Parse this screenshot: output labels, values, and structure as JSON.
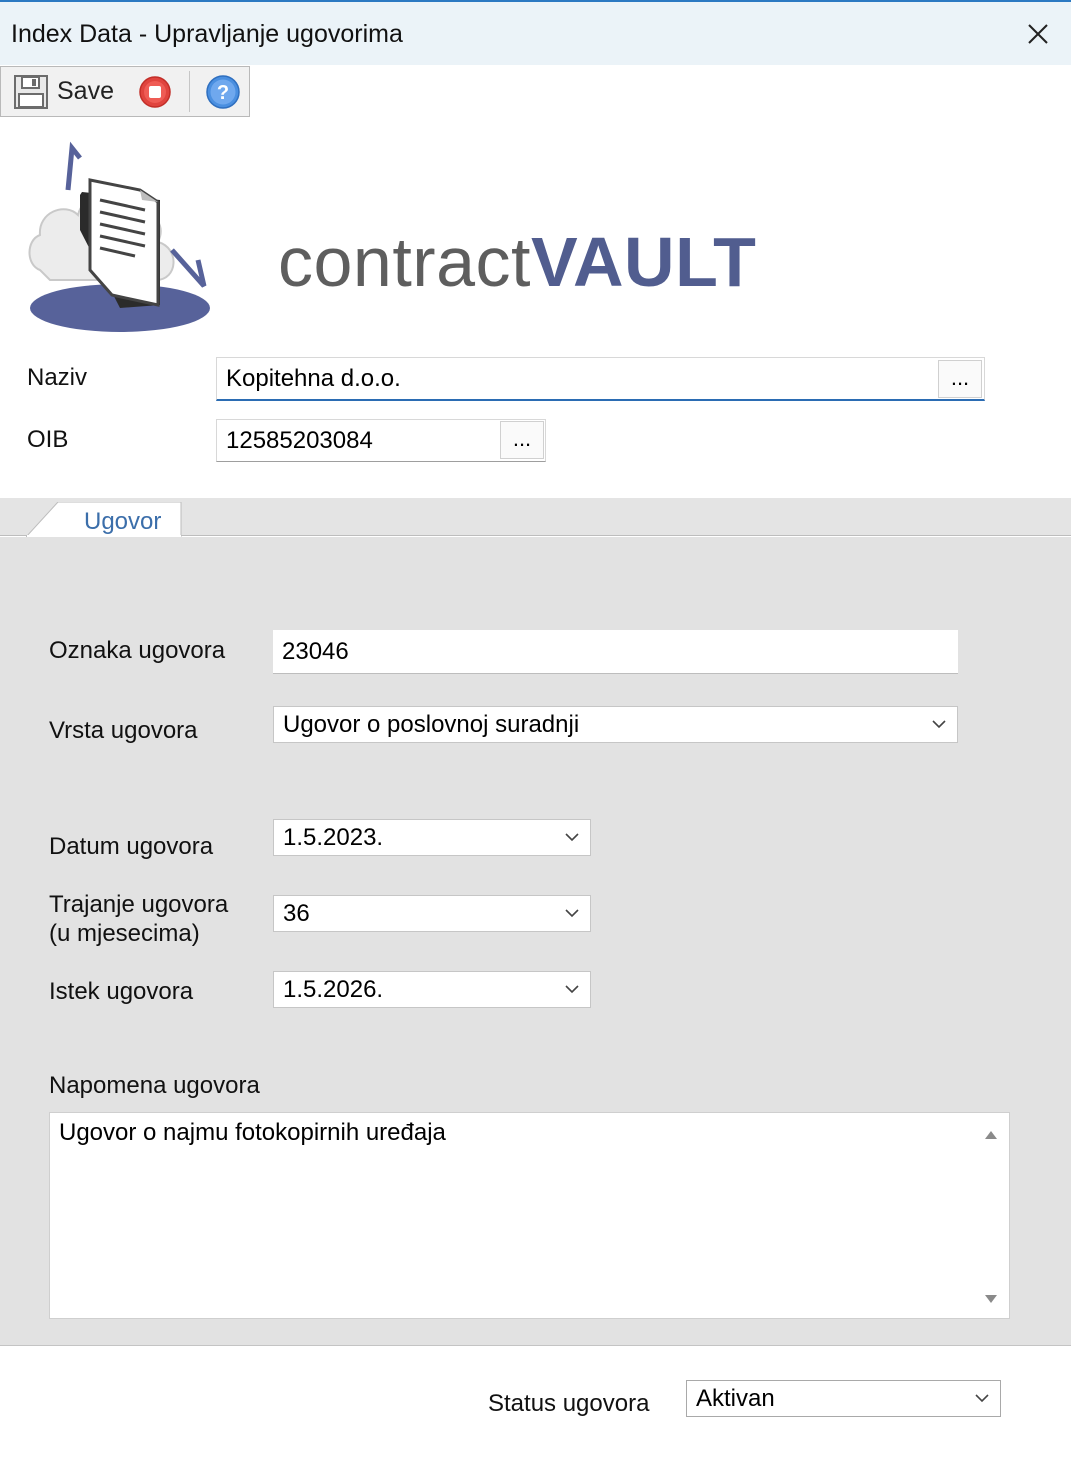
{
  "window": {
    "title": "Index Data - Upravljanje ugovorima"
  },
  "toolbar": {
    "save_label": "Save",
    "stop_icon": "stop-icon",
    "help_icon": "help-icon"
  },
  "brand": {
    "part1": "contract",
    "part2": "VAULT",
    "color_main": "#515d8f",
    "color_gray": "#5e5e5e"
  },
  "header_fields": {
    "naziv_label": "Naziv",
    "naziv_value": "Kopitehna d.o.o.",
    "oib_label": "OIB",
    "oib_value": "12585203084",
    "browse_label": "..."
  },
  "tabs": [
    {
      "label": "Ugovor"
    }
  ],
  "contract": {
    "oznaka_label": "Oznaka ugovora",
    "oznaka_value": "23046",
    "vrsta_label": "Vrsta ugovora",
    "vrsta_value": "Ugovor o poslovnoj suradnji",
    "datum_label": "Datum ugovora",
    "datum_value": "1.5.2023.",
    "trajanje_label_1": "Trajanje ugovora",
    "trajanje_label_2": "(u mjesecima)",
    "trajanje_value": "36",
    "istek_label": "Istek ugovora",
    "istek_value": "1.5.2026.",
    "napomena_label": "Napomena ugovora",
    "napomena_value": "Ugovor o najmu fotokopirnih uređaja"
  },
  "status": {
    "label": "Status ugovora",
    "value": "Aktivan"
  },
  "colors": {
    "titlebar_bg": "#ebf3f8",
    "accent_blue": "#2b79c2",
    "tab_text": "#3b6eaa",
    "panel_bg": "#e2e2e2"
  }
}
